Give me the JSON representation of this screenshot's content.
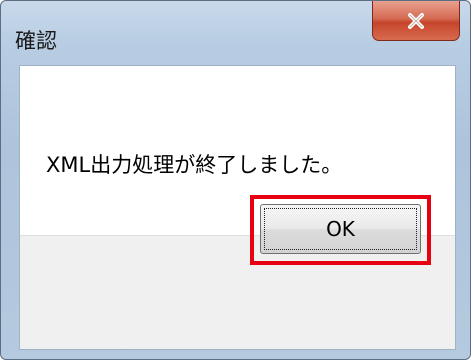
{
  "dialog": {
    "title": "確認",
    "message": "XML出力処理が終了しました。",
    "ok_label": "OK",
    "close_icon": "close-icon"
  },
  "colors": {
    "close_button": "#d56a52",
    "highlight": "#e60012",
    "frame": "#b8cde3"
  }
}
